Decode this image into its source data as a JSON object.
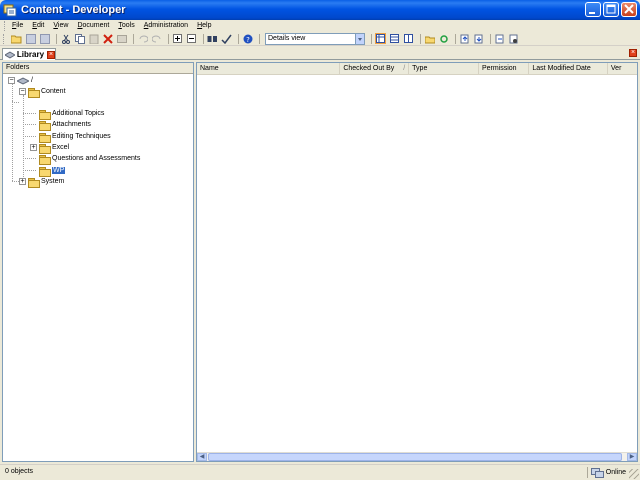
{
  "window": {
    "title": "Content - Developer"
  },
  "menu": {
    "items": [
      "File",
      "Edit",
      "View",
      "Document",
      "Tools",
      "Administration",
      "Help"
    ]
  },
  "toolbar": {
    "view_select_value": "Details view",
    "icons": [
      "open-folder-icon",
      "save-icon",
      "save-all-icon",
      "cut-icon",
      "copy-icon",
      "paste-icon",
      "delete-icon",
      "properties-icon",
      "undo-icon",
      "redo-icon",
      "expand-icon",
      "collapse-icon",
      "find-icon",
      "spell-check-icon",
      "help-icon",
      "details-view-icon",
      "list-view-icon",
      "split-view-icon",
      "publish-icon",
      "refresh-icon",
      "check-in-icon",
      "check-out-icon",
      "import-icon",
      "export-icon"
    ]
  },
  "tabs": [
    {
      "label": "Library"
    }
  ],
  "folders_pane": {
    "header": "Folders",
    "tree": [
      {
        "label": "/",
        "level": 0,
        "expander": "−"
      },
      {
        "label": "Content",
        "level": 1,
        "expander": "−"
      },
      {
        "label": "Additional Topics",
        "level": 2
      },
      {
        "label": "Attachments",
        "level": 2
      },
      {
        "label": "Editing Techniques",
        "level": 2
      },
      {
        "label": "Excel",
        "level": 2,
        "expander": "+"
      },
      {
        "label": "Questions and Assessments",
        "level": 2
      },
      {
        "label": "WP",
        "level": 2,
        "selected": true
      },
      {
        "label": "System",
        "level": 1,
        "expander": "+"
      }
    ]
  },
  "details_pane": {
    "columns": [
      "Name",
      "Checked Out By",
      "Type",
      "Permission",
      "Last Modified Date",
      "Ver"
    ],
    "sort_glyph": "/",
    "rows": []
  },
  "statusbar": {
    "object_count": "0 objects",
    "connection_status": "Online"
  },
  "colors": {
    "titlebar": "#0054e3",
    "selection": "#316ac5",
    "chrome": "#ece9d8"
  }
}
